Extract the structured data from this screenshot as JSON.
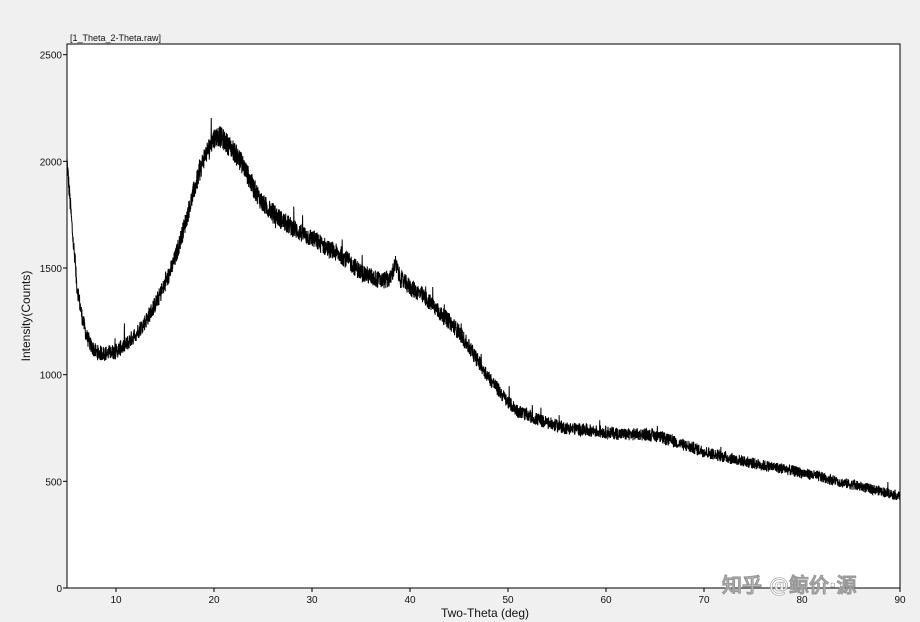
{
  "chart_data": {
    "type": "line",
    "title": "[1_Theta_2-Theta.raw]",
    "xlabel": "Two-Theta (deg)",
    "ylabel": "Intensity(Counts)",
    "xlim": [
      5,
      90
    ],
    "ylim": [
      0,
      2550
    ],
    "xticks": [
      10,
      20,
      30,
      40,
      50,
      60,
      70,
      80,
      90
    ],
    "yticks": [
      0,
      500,
      1000,
      1500,
      2000,
      2500
    ],
    "grid": false,
    "legend": "none",
    "series": [
      {
        "color": "#000000",
        "x": [
          5,
          5.5,
          6,
          6.5,
          7,
          7.5,
          8,
          8.5,
          9,
          10,
          11,
          12,
          13,
          14,
          15,
          16,
          17,
          18,
          19,
          20,
          20.5,
          21,
          22,
          23,
          24,
          25,
          26,
          27,
          28,
          29,
          30,
          31,
          32,
          33,
          34,
          35,
          36,
          37,
          38,
          38.5,
          39,
          40,
          41,
          42,
          43,
          44,
          45,
          46,
          47,
          48,
          49,
          50,
          51,
          52,
          53,
          54,
          55,
          56,
          57,
          58,
          59,
          60,
          61,
          62,
          63,
          64,
          65,
          66,
          67,
          68,
          69,
          70,
          72,
          74,
          76,
          78,
          80,
          82,
          84,
          86,
          88,
          90
        ],
        "y": [
          2000,
          1700,
          1420,
          1280,
          1180,
          1130,
          1105,
          1100,
          1100,
          1110,
          1140,
          1190,
          1250,
          1330,
          1420,
          1540,
          1700,
          1870,
          2020,
          2110,
          2120,
          2100,
          2050,
          1980,
          1880,
          1800,
          1760,
          1720,
          1690,
          1660,
          1640,
          1610,
          1580,
          1560,
          1520,
          1480,
          1460,
          1440,
          1450,
          1520,
          1450,
          1410,
          1380,
          1340,
          1290,
          1250,
          1200,
          1130,
          1060,
          990,
          930,
          870,
          830,
          810,
          790,
          775,
          760,
          750,
          745,
          740,
          735,
          730,
          725,
          720,
          720,
          720,
          715,
          700,
          685,
          670,
          655,
          640,
          615,
          595,
          575,
          560,
          540,
          520,
          495,
          475,
          455,
          430
        ]
      }
    ]
  },
  "watermark": {
    "text": "知乎 @鲸价·源"
  }
}
